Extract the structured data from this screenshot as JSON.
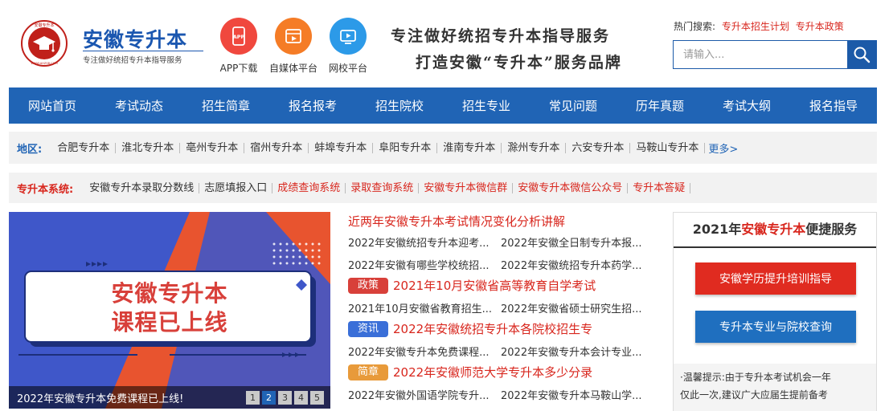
{
  "header": {
    "logo_title": "安徽专升本",
    "logo_subtitle": "专注做好统招专升本指导服务",
    "logo_badge_top": "安徽专升本",
    "logo_badge_bottom": "WWW.AHZSB.COM",
    "apps": [
      {
        "label": "APP下载",
        "icon": "app-download-icon",
        "color": "#f0483e"
      },
      {
        "label": "自媒体平台",
        "icon": "media-icon",
        "color": "#f57c26"
      },
      {
        "label": "网校平台",
        "icon": "play-icon",
        "color": "#2c9ae8"
      }
    ],
    "slogan_line1": "专注做好统招专升本指导服务",
    "slogan_line2": "打造安徽“专升本”服务品牌",
    "hot_search_label": "热门搜索:",
    "hot_search_links": [
      "专升本招生计划",
      "专升本政策"
    ],
    "search_placeholder": "请输入..."
  },
  "nav": {
    "items": [
      "网站首页",
      "考试动态",
      "招生简章",
      "报名报考",
      "招生院校",
      "招生专业",
      "常见问题",
      "历年真题",
      "考试大纲",
      "报名指导"
    ]
  },
  "region": {
    "label": "地区:",
    "items": [
      "合肥专升本",
      "淮北专升本",
      "亳州专升本",
      "宿州专升本",
      "蚌埠专升本",
      "阜阳专升本",
      "淮南专升本",
      "滁州专升本",
      "六安专升本",
      "马鞍山专升本"
    ],
    "more": "更多>"
  },
  "system": {
    "label": "专升本系统:",
    "items": [
      {
        "text": "安徽专升本录取分数线",
        "color": "#333333"
      },
      {
        "text": "志愿填报入口",
        "color": "#333333"
      },
      {
        "text": "成绩查询系统",
        "color": "#d8261d"
      },
      {
        "text": "录取查询系统",
        "color": "#d8261d"
      },
      {
        "text": "安徽专升本微信群",
        "color": "#d8261d"
      },
      {
        "text": "安徽专升本微信公众号",
        "color": "#d8261d"
      },
      {
        "text": "专升本答疑",
        "color": "#d8261d"
      }
    ]
  },
  "banner": {
    "headline_line1": "安徽专升本",
    "headline_line2": "课程已上线",
    "caption": "2022年安徽专升本免费课程已上线!",
    "pages": [
      "1",
      "2",
      "3",
      "4",
      "5"
    ],
    "active_page": "2"
  },
  "news": {
    "blocks": [
      {
        "tag": "",
        "tag_color": "",
        "headline": "近两年安徽专升本考试情况变化分析讲解",
        "rows": [
          [
            "2022年安徽统招专升本迎考...",
            "2022年安徽全日制专升本报..."
          ],
          [
            "2022年安徽有哪些学校统招...",
            "2022年安徽统招专升本药学..."
          ]
        ]
      },
      {
        "tag": "政策",
        "tag_color": "#d8403a",
        "headline": "2021年10月安徽省高等教育自学考试",
        "rows": [
          [
            "2021年10月安徽省教育招生...",
            "2022年安徽省硕士研究生招..."
          ]
        ]
      },
      {
        "tag": "资讯",
        "tag_color": "#3a6fd8",
        "headline": "2022年安徽统招专升本各院校招生专",
        "rows": [
          [
            "2022年安徽专升本免费课程...",
            "2022年安徽专升本会计专业..."
          ]
        ]
      },
      {
        "tag": "简章",
        "tag_color": "#e89a3a",
        "headline": "2022年安徽师范大学专升本多少分录",
        "rows": [
          [
            "2022年安徽外国语学院专升...",
            "2022年安徽专升本马鞍山学..."
          ]
        ]
      }
    ]
  },
  "service": {
    "title_year": "2021年",
    "title_accent": "安徽专升本",
    "title_rest": "便捷服务",
    "btn_training": "安徽学历提升培训指导",
    "btn_training_color": "#e02b20",
    "btn_query": "专升本专业与院校查询",
    "btn_query_color": "#1f6fbf",
    "tips_line1": "·温馨提示:由于专升本考试机会一年",
    "tips_line2": "仅此一次,建议广大应届生提前备考"
  }
}
